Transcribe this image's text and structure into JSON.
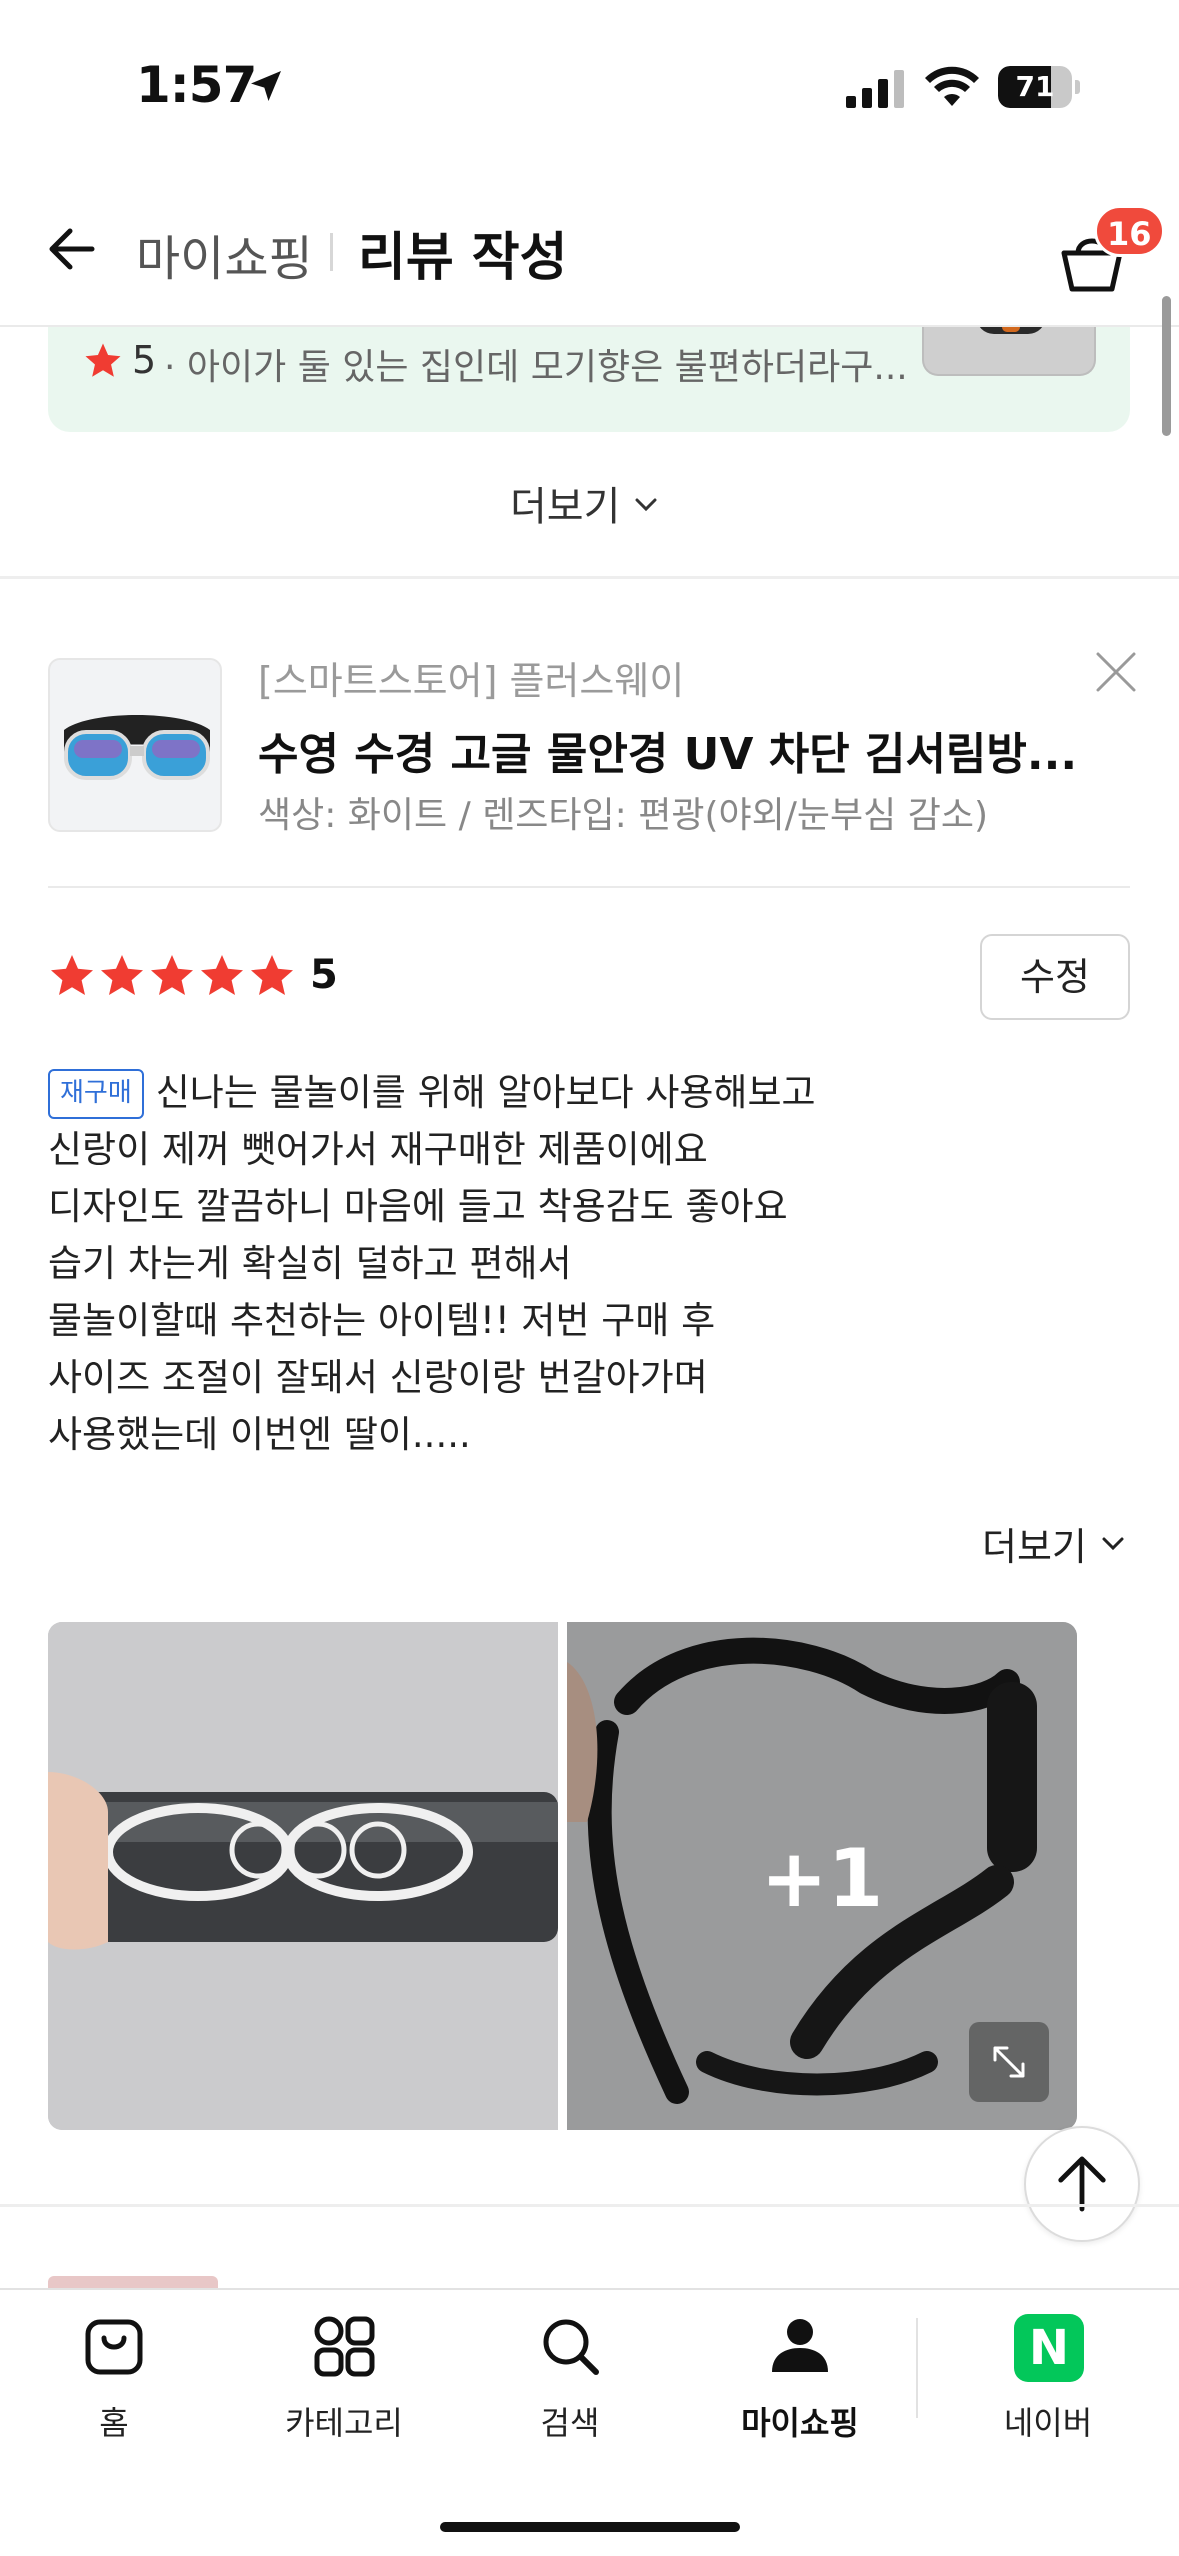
{
  "status_bar": {
    "time": "1:57",
    "battery": "71",
    "battery_level": 0.71
  },
  "header": {
    "breadcrumb": "마이쇼핑",
    "title": "리뷰 작성",
    "cart_count": "16"
  },
  "previous_review": {
    "score": "5",
    "snippet": "· 아이가 둘 있는 집인데 모기향은 불편하더라구..."
  },
  "more_label_top": "더보기",
  "product": {
    "store": "[스마트스토어] 플러스웨이",
    "name": "수영 수경 고글 물안경 UV 차단 김서림방...",
    "option": "색상: 화이트 / 렌즈타입: 편광(야외/눈부심 감소)"
  },
  "review": {
    "rating": "5",
    "rating_value": 5,
    "edit_label": "수정",
    "badge": "재구매",
    "lines": [
      "신나는 물놀이를 위해 알아보다 사용해보고",
      "신랑이 제꺼 뺏어가서 재구매한 제품이에요",
      "디자인도 깔끔하니 마음에 들고 착용감도 좋아요",
      "습기 차는게 확실히 덜하고 편해서",
      "물놀이할때 추천하는 아이템!! 저번 구매 후",
      "사이즈 조절이 잘돼서 신랑이랑 번갈아가며",
      "사용했는데 이번엔 딸이....."
    ],
    "more_label": "더보기",
    "extra_photos": "+1"
  },
  "tabs": [
    {
      "label": "홈",
      "icon": "shopping-bag-icon"
    },
    {
      "label": "카테고리",
      "icon": "category-grid-icon"
    },
    {
      "label": "검색",
      "icon": "search-icon"
    },
    {
      "label": "마이쇼핑",
      "icon": "person-icon"
    },
    {
      "label": "네이버",
      "icon": "naver-logo"
    }
  ],
  "naver_letter": "N",
  "colors": {
    "accent_red": "#f04a3c",
    "star": "#f03c32",
    "badge_blue": "#2f6fd8",
    "naver_green": "#03c75a",
    "summary_bg": "#eaf7ef"
  }
}
